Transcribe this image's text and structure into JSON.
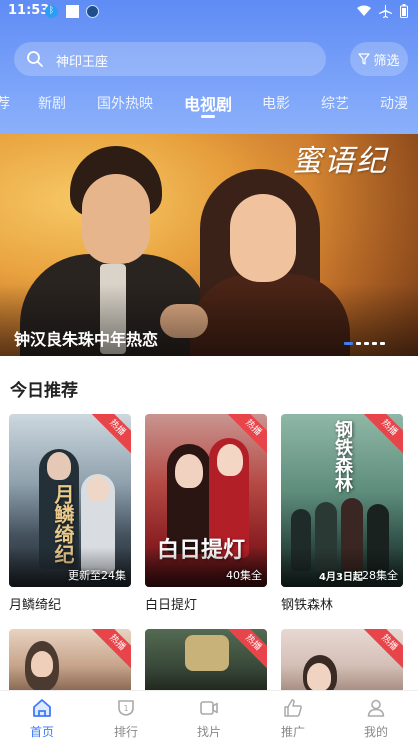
{
  "status_bar": {
    "time": "11:53",
    "icons": [
      "bluetooth-icon",
      "square-icon",
      "app-icon",
      "wifi-icon",
      "airplane-icon",
      "battery-icon"
    ]
  },
  "search": {
    "text": "神印王座",
    "filter_label": "筛选"
  },
  "tabs": [
    {
      "label": "荐",
      "active": false
    },
    {
      "label": "新剧",
      "active": false
    },
    {
      "label": "国外热映",
      "active": false
    },
    {
      "label": "电视剧",
      "active": true
    },
    {
      "label": "电影",
      "active": false
    },
    {
      "label": "综艺",
      "active": false
    },
    {
      "label": "动漫",
      "active": false
    }
  ],
  "banner": {
    "caption": "钟汉良朱珠中年热恋",
    "logo_text": "蜜语纪",
    "dots_count": 5,
    "active_dot": 0
  },
  "section": {
    "title": "今日推荐"
  },
  "cards": [
    {
      "title": "月鳞绮纪",
      "badge": "热播",
      "status": "更新至24集",
      "art_text": "月鳞绮纪"
    },
    {
      "title": "白日提灯",
      "badge": "热播",
      "status": "40集全",
      "art_text": "白日提灯"
    },
    {
      "title": "钢铁森林",
      "badge": "热播",
      "status": "28集全",
      "art_text": "钢铁森林",
      "extra_text": "4月3日起"
    },
    {
      "title": "",
      "badge": "热播",
      "status": ""
    },
    {
      "title": "",
      "badge": "热播",
      "status": ""
    },
    {
      "title": "",
      "badge": "热播",
      "status": ""
    }
  ],
  "bottom_nav": [
    {
      "label": "首页",
      "icon": "home-icon",
      "active": true
    },
    {
      "label": "排行",
      "icon": "ranking-icon",
      "active": false
    },
    {
      "label": "找片",
      "icon": "video-icon",
      "active": false
    },
    {
      "label": "推广",
      "icon": "thumbs-up-icon",
      "active": false
    },
    {
      "label": "我的",
      "icon": "profile-icon",
      "active": false
    }
  ],
  "colors": {
    "accent": "#3f7cf5",
    "header_top": "#5f8cf5",
    "badge": "#e8454b"
  }
}
